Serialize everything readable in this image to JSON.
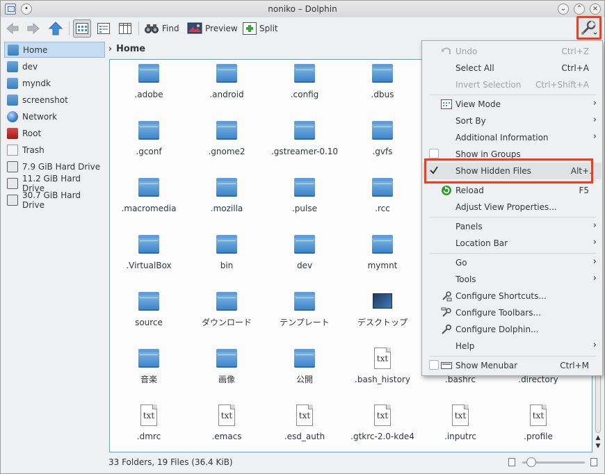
{
  "window": {
    "title": "noniko – Dolphin"
  },
  "toolbar": {
    "find": "Find",
    "preview": "Preview",
    "split": "Split"
  },
  "places": [
    {
      "label": "Home",
      "icon": "home-icon"
    },
    {
      "label": "dev",
      "icon": "folder-icon"
    },
    {
      "label": "myndk",
      "icon": "folder-icon"
    },
    {
      "label": "screenshot",
      "icon": "folder-icon"
    },
    {
      "label": "Network",
      "icon": "network-icon"
    },
    {
      "label": "Root",
      "icon": "root-folder-icon"
    },
    {
      "label": "Trash",
      "icon": "trash-icon"
    },
    {
      "label": "7.9 GiB Hard Drive",
      "icon": "drive-icon"
    },
    {
      "label": "11.2 GiB Hard Drive",
      "icon": "drive-icon"
    },
    {
      "label": "30.7 GiB Hard Drive",
      "icon": "drive-icon"
    }
  ],
  "breadcrumb": {
    "location": "Home"
  },
  "files": [
    {
      "name": ".adobe",
      "type": "folder"
    },
    {
      "name": ".android",
      "type": "folder"
    },
    {
      "name": ".config",
      "type": "folder"
    },
    {
      "name": ".dbus",
      "type": "folder"
    },
    {
      "name": ".gconf",
      "type": "folder"
    },
    {
      "name": ".gnome2",
      "type": "folder"
    },
    {
      "name": ".gstreamer-0.10",
      "type": "folder"
    },
    {
      "name": ".gvfs",
      "type": "folder"
    },
    {
      "name": ".macromedia",
      "type": "folder"
    },
    {
      "name": ".mozilla",
      "type": "folder"
    },
    {
      "name": ".pulse",
      "type": "folder"
    },
    {
      "name": ".rcc",
      "type": "folder"
    },
    {
      "name": ".VirtualBox",
      "type": "folder"
    },
    {
      "name": "bin",
      "type": "folder"
    },
    {
      "name": "dev",
      "type": "folder"
    },
    {
      "name": "mymnt",
      "type": "folder"
    },
    {
      "name": "source",
      "type": "folder"
    },
    {
      "name": "ダウンロード",
      "type": "folder"
    },
    {
      "name": "テンプレート",
      "type": "folder"
    },
    {
      "name": "デスクトップ",
      "type": "desktop"
    },
    {
      "name": "音楽",
      "type": "folder"
    },
    {
      "name": "画像",
      "type": "folder"
    },
    {
      "name": "公開",
      "type": "folder"
    },
    {
      "name": ".bash_history",
      "type": "text"
    },
    {
      "name": ".bashrc",
      "type": "text"
    },
    {
      "name": ".directory",
      "type": "text"
    },
    {
      "name": ".dmrc",
      "type": "text"
    },
    {
      "name": ".emacs",
      "type": "text"
    },
    {
      "name": ".esd_auth",
      "type": "text"
    },
    {
      "name": ".gtkrc-2.0-kde4",
      "type": "text"
    },
    {
      "name": ".inputrc",
      "type": "text"
    },
    {
      "name": ".profile",
      "type": "text"
    }
  ],
  "file_icon_text": "txt",
  "status": {
    "text": "33 Folders, 19 Files (36.4 KiB)"
  },
  "menu": {
    "undo": {
      "label": "Undo",
      "shortcut": "Ctrl+Z"
    },
    "select_all": {
      "label": "Select All",
      "shortcut": "Ctrl+A"
    },
    "invert_selection": {
      "label": "Invert Selection",
      "shortcut": "Ctrl+Shift+A"
    },
    "view_mode": {
      "label": "View Mode"
    },
    "sort_by": {
      "label": "Sort By"
    },
    "additional_info": {
      "label": "Additional Information"
    },
    "show_in_groups": {
      "label": "Show in Groups"
    },
    "show_hidden": {
      "label": "Show Hidden Files",
      "shortcut": "Alt+."
    },
    "reload": {
      "label": "Reload",
      "shortcut": "F5"
    },
    "adjust_view": {
      "label": "Adjust View Properties..."
    },
    "panels": {
      "label": "Panels"
    },
    "location_bar": {
      "label": "Location Bar"
    },
    "go": {
      "label": "Go"
    },
    "tools": {
      "label": "Tools"
    },
    "configure_shortcuts": {
      "label": "Configure Shortcuts..."
    },
    "configure_toolbars": {
      "label": "Configure Toolbars..."
    },
    "configure_dolphin": {
      "label": "Configure Dolphin..."
    },
    "help": {
      "label": "Help"
    },
    "show_menubar": {
      "label": "Show Menubar",
      "shortcut": "Ctrl+M"
    }
  },
  "colors": {
    "accent": "#3daee9",
    "highlight_box": "#ee3d21",
    "folder": "#3f86cb"
  }
}
